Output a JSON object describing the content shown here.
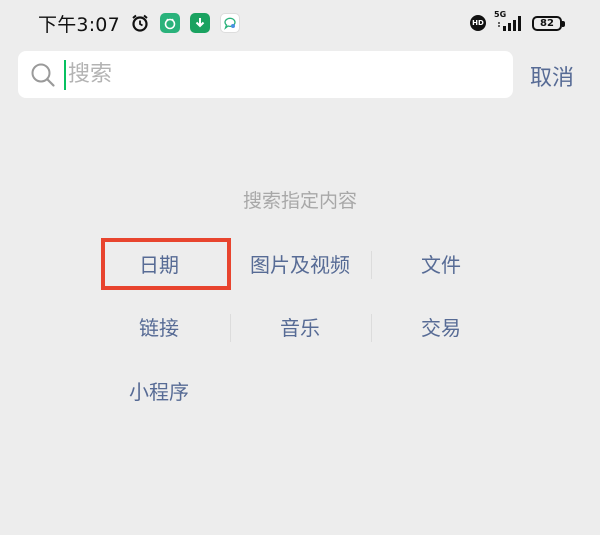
{
  "status_bar": {
    "time": "下午3:07",
    "network": "5G",
    "battery": "82"
  },
  "search": {
    "placeholder": "搜索",
    "cancel_label": "取消"
  },
  "section": {
    "title": "搜索指定内容",
    "options": [
      "日期",
      "图片及视频",
      "文件",
      "链接",
      "音乐",
      "交易",
      "小程序"
    ]
  },
  "colors": {
    "background": "#ededed",
    "link": "#576b95",
    "caret": "#07c160",
    "highlight": "#e8442e"
  }
}
